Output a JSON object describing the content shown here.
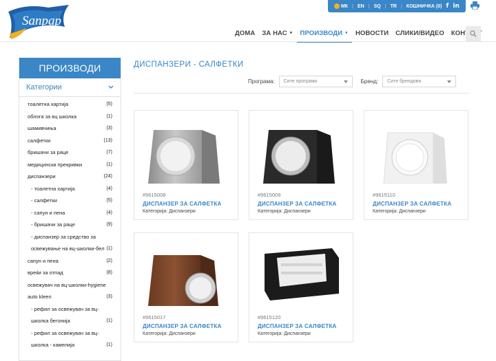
{
  "topbar": {
    "lang_mk": "МК",
    "lang_en": "EN",
    "lang_sq": "SQ",
    "lang_tr": "TR",
    "cart": "КОШНИЧКА (0)",
    "sep": "|",
    "facebook": "f",
    "linkedin": "in"
  },
  "logo": {
    "text": "Sanpap"
  },
  "nav": {
    "items": [
      {
        "label": "ДОМА"
      },
      {
        "label": "ЗА НАС"
      },
      {
        "label": "ПРОИЗВОДИ"
      },
      {
        "label": "НОВОСТИ"
      },
      {
        "label": "СЛИКИ/ВИДЕО"
      },
      {
        "label": "КОНТАКТ"
      }
    ]
  },
  "sidebar": {
    "title": "ПРОИЗВОДИ",
    "categories_title": "Категории",
    "items": [
      {
        "label": "тоалетна хартија",
        "count": "(5)"
      },
      {
        "label": "облога за вц школка",
        "count": "(1)"
      },
      {
        "label": "шамивчиња",
        "count": "(3)"
      },
      {
        "label": "салфетки",
        "count": "(13)"
      },
      {
        "label": "бришачи за раце",
        "count": "(7)"
      },
      {
        "label": "медицински прекривки",
        "count": "(1)"
      },
      {
        "label": "диспанзери",
        "count": "(24)"
      },
      {
        "label": "- тоалетна хартија",
        "count": "(4)"
      },
      {
        "label": "- салфетки",
        "count": "(5)"
      },
      {
        "label": "- сапун и пена",
        "count": "(4)"
      },
      {
        "label": "- бришачи за раце",
        "count": "(9)"
      },
      {
        "label": "- диспанзер за средство за освежување на вц-школки-бел",
        "count": "(1)"
      },
      {
        "label": "сапун и пена",
        "count": "(2)"
      },
      {
        "label": "вреќи за отпад",
        "count": "(8)"
      },
      {
        "label": "освежувач на вц-школки-hygiene auto kleen",
        "count": "(3)"
      },
      {
        "label": "- рефил за освежувач за вц-школка бегонија",
        "count": "(1)"
      },
      {
        "label": "- рефил за освежувач за вц-школка - камелија",
        "count": "(1)"
      }
    ]
  },
  "main": {
    "title": "ДИСПАНЗЕРИ - САЛФЕТКИ",
    "filter_program_label": "Програма:",
    "filter_program_value": "Сите програми",
    "filter_brand_label": "Бренд:",
    "filter_brand_value": "Сите брендови"
  },
  "products": [
    {
      "code": "#9615008",
      "name": "ДИСПАНЗЕР ЗА САЛФЕТКА",
      "category": "Категорија: Диспанзери"
    },
    {
      "code": "#9615009",
      "name": "ДИСПАНЗЕР ЗА САЛФЕТКА",
      "category": "Категорија: Диспанзери"
    },
    {
      "code": "#9615110",
      "name": "ДИСПАНЗЕР ЗА САЛФЕТКА",
      "category": "Категорија: Диспанзери"
    },
    {
      "code": "#9615017",
      "name": "ДИСПАНЗЕР ЗА САЛФЕТКА",
      "category": "Категорија: Диспанзери"
    },
    {
      "code": "#9615120",
      "name": "ДИСПАНЗЕР ЗА САЛФЕТКА",
      "category": "Категорија: Диспанзери"
    }
  ],
  "colors": {
    "accent": "#3a86c6",
    "globe": "#f3b01b"
  }
}
